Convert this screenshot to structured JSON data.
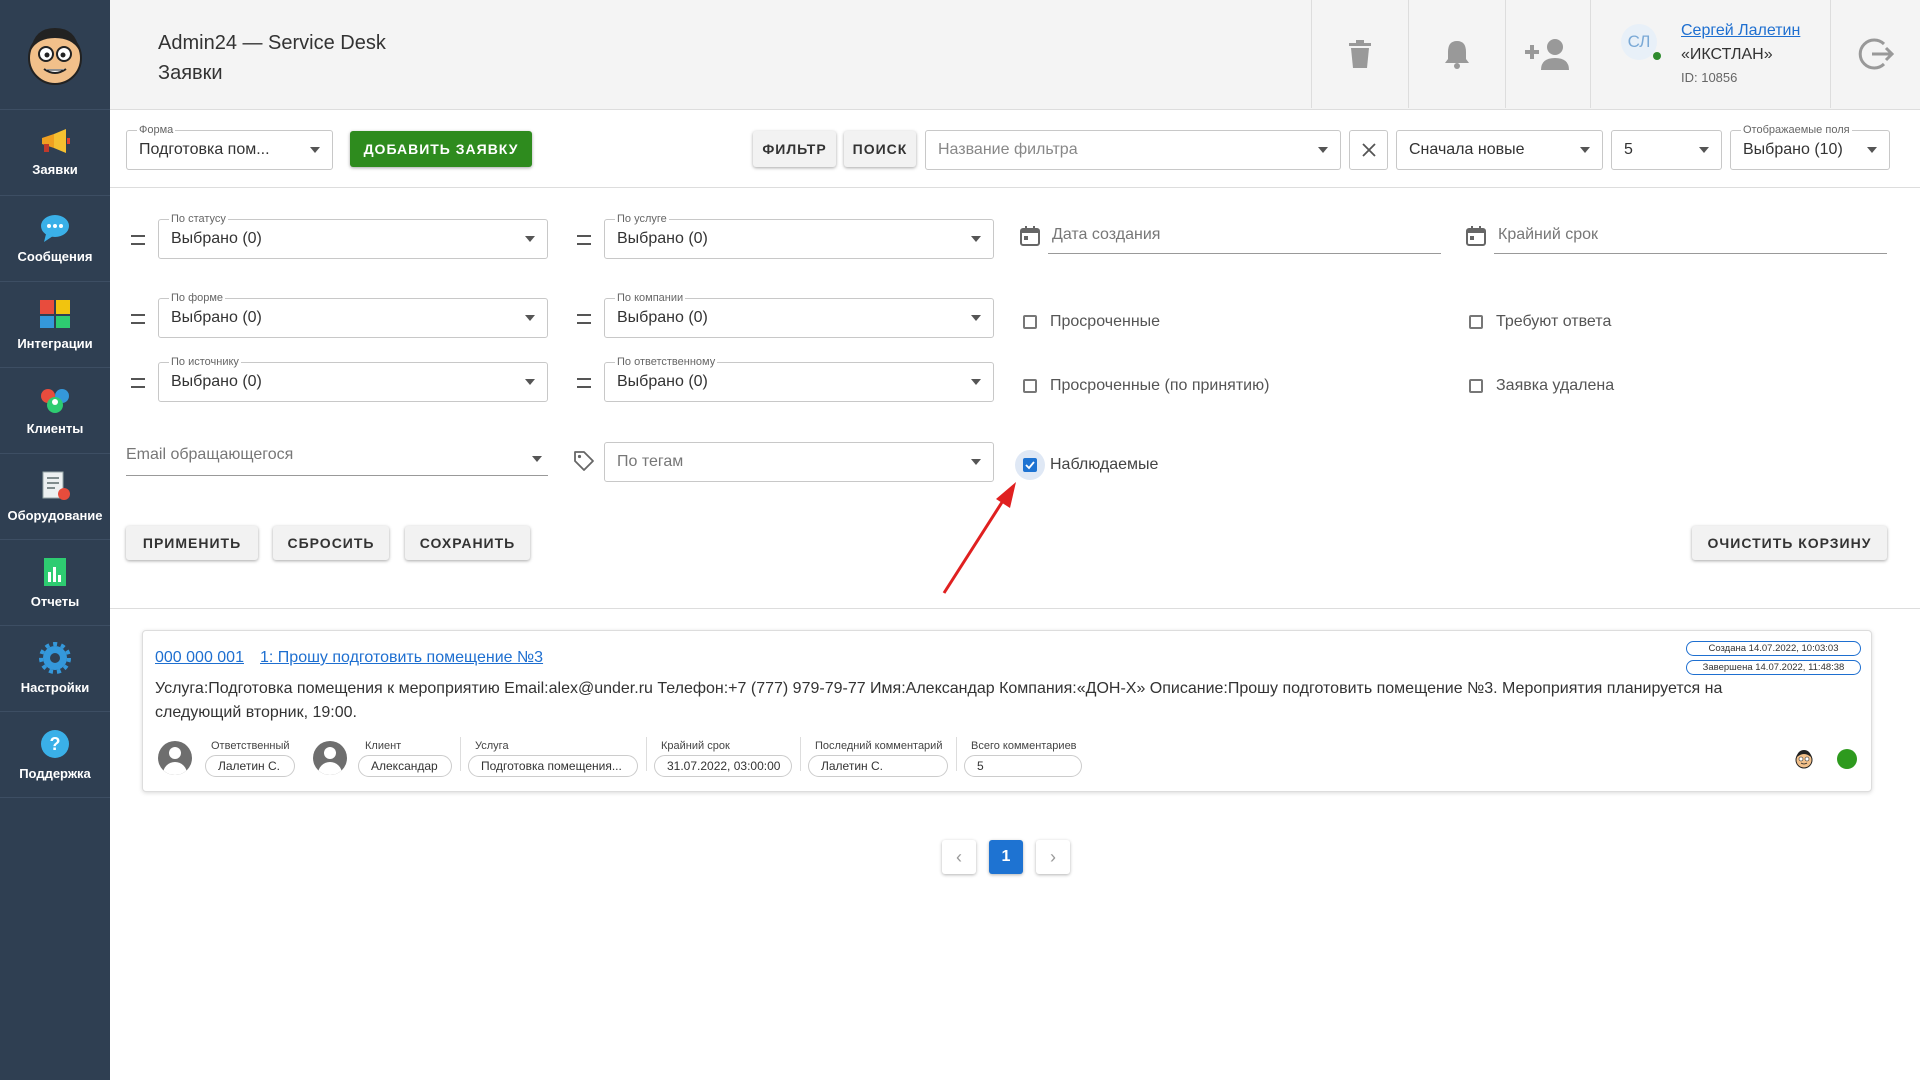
{
  "sidebar": {
    "items": [
      {
        "label": "Заявки",
        "icon": "megaphone-icon"
      },
      {
        "label": "Сообщения",
        "icon": "chat-icon"
      },
      {
        "label": "Интеграции",
        "icon": "puzzle-icon"
      },
      {
        "label": "Клиенты",
        "icon": "clients-icon"
      },
      {
        "label": "Оборудование",
        "icon": "equipment-icon"
      },
      {
        "label": "Отчеты",
        "icon": "report-icon"
      },
      {
        "label": "Настройки",
        "icon": "gear-icon"
      },
      {
        "label": "Поддержка",
        "icon": "help-icon"
      }
    ]
  },
  "header": {
    "app_name": "Admin24 — Service Desk",
    "page_name": "Заявки",
    "user": {
      "initials": "СЛ",
      "name": "Сергей Лалетин",
      "company": "«ИКСТЛАН»",
      "id": "ID: 10856"
    }
  },
  "toolbar": {
    "form_label": "Форма",
    "form_value": "Подготовка пом...",
    "add_button": "ДОБАВИТЬ ЗАЯВКУ",
    "filter_button": "ФИЛЬТР",
    "search_button": "ПОИСК",
    "filter_name_placeholder": "Название фильтра",
    "sort_value": "Сначала новые",
    "per_page_value": "5",
    "fields_label": "Отображаемые поля",
    "fields_value": "Выбрано (10)"
  },
  "filters": {
    "status": {
      "label": "По статусу",
      "value": "Выбрано (0)"
    },
    "service": {
      "label": "По услуге",
      "value": "Выбрано (0)"
    },
    "form": {
      "label": "По форме",
      "value": "Выбрано (0)"
    },
    "company": {
      "label": "По компании",
      "value": "Выбрано (0)"
    },
    "source": {
      "label": "По источнику",
      "value": "Выбрано (0)"
    },
    "responsible": {
      "label": "По ответственному",
      "value": "Выбрано (0)"
    },
    "email_placeholder": "Email обращающегося",
    "tags_placeholder": "По тегам",
    "created_date": "Дата создания",
    "deadline": "Крайний срок",
    "checkboxes": {
      "overdue": {
        "label": "Просроченные",
        "checked": false
      },
      "need_reply": {
        "label": "Требуют ответа",
        "checked": false
      },
      "overdue_accept": {
        "label": "Просроченные (по принятию)",
        "checked": false
      },
      "deleted": {
        "label": "Заявка удалена",
        "checked": false
      },
      "watched": {
        "label": "Наблюдаемые",
        "checked": true
      }
    },
    "apply_button": "ПРИМЕНИТЬ",
    "reset_button": "СБРОСИТЬ",
    "save_button": "СОХРАНИТЬ",
    "clear_trash_button": "ОЧИСТИТЬ КОРЗИНУ"
  },
  "ticket": {
    "number": "000 000 001",
    "title": "1: Прошу подготовить помещение №3",
    "created": "Создана 14.07.2022, 10:03:03",
    "finished": "Завершена 14.07.2022, 11:48:38",
    "description": "Услуга:Подготовка помещения к мероприятию Email:alex@under.ru Телефон:+7 (777) 979-79-77 Имя:Александар Компания:«ДОН-Х» Описание:Прошу подготовить помещение №3. Мероприятия планируется на следующий вторник, 19:00.",
    "meta": {
      "responsible_label": "Ответственный",
      "responsible_value": "Лалетин С.",
      "client_label": "Клиент",
      "client_value": "Александар",
      "service_label": "Услуга",
      "service_value": "Подготовка помещения...",
      "deadline_label": "Крайний срок",
      "deadline_value": "31.07.2022, 03:00:00",
      "last_comment_label": "Последний комментарий",
      "last_comment_value": "Лалетин С.",
      "total_comments_label": "Всего комментариев",
      "total_comments_value": "5"
    },
    "status_color": "#2e9a1e"
  },
  "pagination": {
    "prev": "‹",
    "current": "1",
    "next": "›"
  },
  "colors": {
    "sidebar_bg": "#2f3f52",
    "accent_green": "#2e8b1e",
    "link_blue": "#1e6fd0",
    "arrow_red": "#e02020"
  }
}
